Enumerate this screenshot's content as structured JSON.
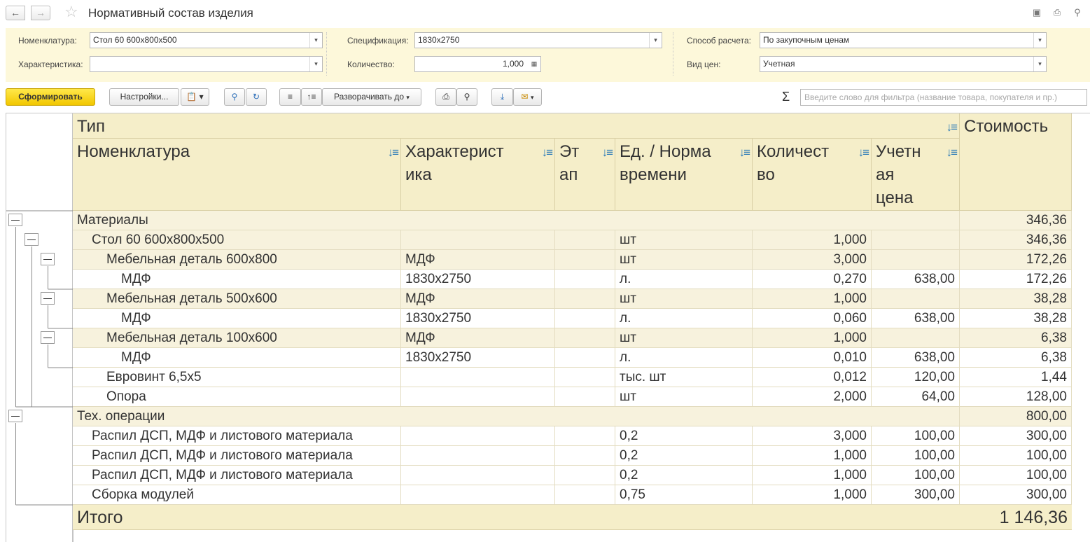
{
  "window": {
    "title": "Нормативный состав изделия",
    "icons": [
      "back-arrow-icon",
      "forward-arrow-icon",
      "favorite-star-icon",
      "save-icon",
      "print-icon",
      "preview-icon"
    ]
  },
  "params": {
    "nomenclature_label": "Номенклатура:",
    "nomenclature_value": "Стол 60 600x800x500",
    "characteristic_label": "Характеристика:",
    "characteristic_value": "",
    "specification_label": "Спецификация:",
    "specification_value": "1830x2750",
    "quantity_label": "Количество:",
    "quantity_value": "1,000",
    "calc_method_label": "Способ расчета:",
    "calc_method_value": "По закупочным ценам",
    "price_type_label": "Вид цен:",
    "price_type_value": "Учетная"
  },
  "toolbar": {
    "generate_label": "Сформировать",
    "settings_label": "Настройки...",
    "expand_label": "Разворачивать до",
    "filter_placeholder": "Введите слово для фильтра (название товара, покупателя и пр.)",
    "sigma": "Σ"
  },
  "report": {
    "headers": {
      "type": "Тип",
      "cost": "Стоимость",
      "nomenclature": "Номенклатура",
      "characteristic": "Характерист ика",
      "stage": "Эт ап",
      "unit": "Ед. / Норма времени",
      "quantity": "Количест во",
      "price": "Учетн ая цена"
    },
    "rows": [
      {
        "name": "Материалы",
        "char": "",
        "stage": "",
        "unit": "",
        "qty": "",
        "price": "",
        "cost": "346,36",
        "level": 0,
        "group": true
      },
      {
        "name": "Стол 60 600x800x500",
        "char": "",
        "stage": "",
        "unit": "шт",
        "qty": "1,000",
        "price": "",
        "cost": "346,36",
        "level": 1,
        "group": true
      },
      {
        "name": "Мебельная деталь 600x800",
        "char": "МДФ",
        "stage": "",
        "unit": "шт",
        "qty": "3,000",
        "price": "",
        "cost": "172,26",
        "level": 2,
        "group": true
      },
      {
        "name": "МДФ",
        "char": "1830x2750",
        "stage": "",
        "unit": "л.",
        "qty": "0,270",
        "price": "638,00",
        "cost": "172,26",
        "level": 3,
        "group": false
      },
      {
        "name": "Мебельная деталь 500x600",
        "char": "МДФ",
        "stage": "",
        "unit": "шт",
        "qty": "1,000",
        "price": "",
        "cost": "38,28",
        "level": 2,
        "group": true
      },
      {
        "name": "МДФ",
        "char": "1830x2750",
        "stage": "",
        "unit": "л.",
        "qty": "0,060",
        "price": "638,00",
        "cost": "38,28",
        "level": 3,
        "group": false
      },
      {
        "name": "Мебельная деталь 100x600",
        "char": "МДФ",
        "stage": "",
        "unit": "шт",
        "qty": "1,000",
        "price": "",
        "cost": "6,38",
        "level": 2,
        "group": true
      },
      {
        "name": "МДФ",
        "char": "1830x2750",
        "stage": "",
        "unit": "л.",
        "qty": "0,010",
        "price": "638,00",
        "cost": "6,38",
        "level": 3,
        "group": false
      },
      {
        "name": "Евровинт 6,5х5",
        "char": "",
        "stage": "",
        "unit": "тыс. шт",
        "qty": "0,012",
        "price": "120,00",
        "cost": "1,44",
        "level": 2,
        "group": false
      },
      {
        "name": "Опора",
        "char": "",
        "stage": "",
        "unit": "шт",
        "qty": "2,000",
        "price": "64,00",
        "cost": "128,00",
        "level": 2,
        "group": false
      },
      {
        "name": "Тех. операции",
        "char": "",
        "stage": "",
        "unit": "",
        "qty": "",
        "price": "",
        "cost": "800,00",
        "level": 0,
        "group": true
      },
      {
        "name": "Распил ДСП, МДФ и листового материала",
        "char": "",
        "stage": "",
        "unit": "0,2",
        "qty": "3,000",
        "price": "100,00",
        "cost": "300,00",
        "level": 1,
        "group": false
      },
      {
        "name": "Распил ДСП, МДФ и листового материала",
        "char": "",
        "stage": "",
        "unit": "0,2",
        "qty": "1,000",
        "price": "100,00",
        "cost": "100,00",
        "level": 1,
        "group": false
      },
      {
        "name": "Распил ДСП, МДФ и листового материала",
        "char": "",
        "stage": "",
        "unit": "0,2",
        "qty": "1,000",
        "price": "100,00",
        "cost": "100,00",
        "level": 1,
        "group": false
      },
      {
        "name": "Сборка модулей",
        "char": "",
        "stage": "",
        "unit": "0,75",
        "qty": "1,000",
        "price": "300,00",
        "cost": "300,00",
        "level": 1,
        "group": false
      }
    ],
    "total_label": "Итого",
    "total_value": "1 146,36"
  }
}
